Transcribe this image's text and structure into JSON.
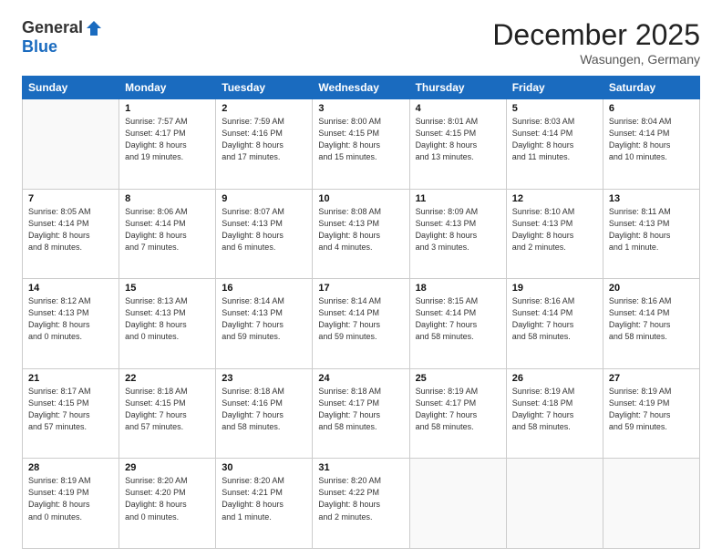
{
  "logo": {
    "general": "General",
    "blue": "Blue"
  },
  "title": {
    "month": "December 2025",
    "location": "Wasungen, Germany"
  },
  "days_of_week": [
    "Sunday",
    "Monday",
    "Tuesday",
    "Wednesday",
    "Thursday",
    "Friday",
    "Saturday"
  ],
  "weeks": [
    [
      {
        "day": "",
        "info": ""
      },
      {
        "day": "1",
        "info": "Sunrise: 7:57 AM\nSunset: 4:17 PM\nDaylight: 8 hours\nand 19 minutes."
      },
      {
        "day": "2",
        "info": "Sunrise: 7:59 AM\nSunset: 4:16 PM\nDaylight: 8 hours\nand 17 minutes."
      },
      {
        "day": "3",
        "info": "Sunrise: 8:00 AM\nSunset: 4:15 PM\nDaylight: 8 hours\nand 15 minutes."
      },
      {
        "day": "4",
        "info": "Sunrise: 8:01 AM\nSunset: 4:15 PM\nDaylight: 8 hours\nand 13 minutes."
      },
      {
        "day": "5",
        "info": "Sunrise: 8:03 AM\nSunset: 4:14 PM\nDaylight: 8 hours\nand 11 minutes."
      },
      {
        "day": "6",
        "info": "Sunrise: 8:04 AM\nSunset: 4:14 PM\nDaylight: 8 hours\nand 10 minutes."
      }
    ],
    [
      {
        "day": "7",
        "info": "Sunrise: 8:05 AM\nSunset: 4:14 PM\nDaylight: 8 hours\nand 8 minutes."
      },
      {
        "day": "8",
        "info": "Sunrise: 8:06 AM\nSunset: 4:14 PM\nDaylight: 8 hours\nand 7 minutes."
      },
      {
        "day": "9",
        "info": "Sunrise: 8:07 AM\nSunset: 4:13 PM\nDaylight: 8 hours\nand 6 minutes."
      },
      {
        "day": "10",
        "info": "Sunrise: 8:08 AM\nSunset: 4:13 PM\nDaylight: 8 hours\nand 4 minutes."
      },
      {
        "day": "11",
        "info": "Sunrise: 8:09 AM\nSunset: 4:13 PM\nDaylight: 8 hours\nand 3 minutes."
      },
      {
        "day": "12",
        "info": "Sunrise: 8:10 AM\nSunset: 4:13 PM\nDaylight: 8 hours\nand 2 minutes."
      },
      {
        "day": "13",
        "info": "Sunrise: 8:11 AM\nSunset: 4:13 PM\nDaylight: 8 hours\nand 1 minute."
      }
    ],
    [
      {
        "day": "14",
        "info": "Sunrise: 8:12 AM\nSunset: 4:13 PM\nDaylight: 8 hours\nand 0 minutes."
      },
      {
        "day": "15",
        "info": "Sunrise: 8:13 AM\nSunset: 4:13 PM\nDaylight: 8 hours\nand 0 minutes."
      },
      {
        "day": "16",
        "info": "Sunrise: 8:14 AM\nSunset: 4:13 PM\nDaylight: 7 hours\nand 59 minutes."
      },
      {
        "day": "17",
        "info": "Sunrise: 8:14 AM\nSunset: 4:14 PM\nDaylight: 7 hours\nand 59 minutes."
      },
      {
        "day": "18",
        "info": "Sunrise: 8:15 AM\nSunset: 4:14 PM\nDaylight: 7 hours\nand 58 minutes."
      },
      {
        "day": "19",
        "info": "Sunrise: 8:16 AM\nSunset: 4:14 PM\nDaylight: 7 hours\nand 58 minutes."
      },
      {
        "day": "20",
        "info": "Sunrise: 8:16 AM\nSunset: 4:14 PM\nDaylight: 7 hours\nand 58 minutes."
      }
    ],
    [
      {
        "day": "21",
        "info": "Sunrise: 8:17 AM\nSunset: 4:15 PM\nDaylight: 7 hours\nand 57 minutes."
      },
      {
        "day": "22",
        "info": "Sunrise: 8:18 AM\nSunset: 4:15 PM\nDaylight: 7 hours\nand 57 minutes."
      },
      {
        "day": "23",
        "info": "Sunrise: 8:18 AM\nSunset: 4:16 PM\nDaylight: 7 hours\nand 58 minutes."
      },
      {
        "day": "24",
        "info": "Sunrise: 8:18 AM\nSunset: 4:17 PM\nDaylight: 7 hours\nand 58 minutes."
      },
      {
        "day": "25",
        "info": "Sunrise: 8:19 AM\nSunset: 4:17 PM\nDaylight: 7 hours\nand 58 minutes."
      },
      {
        "day": "26",
        "info": "Sunrise: 8:19 AM\nSunset: 4:18 PM\nDaylight: 7 hours\nand 58 minutes."
      },
      {
        "day": "27",
        "info": "Sunrise: 8:19 AM\nSunset: 4:19 PM\nDaylight: 7 hours\nand 59 minutes."
      }
    ],
    [
      {
        "day": "28",
        "info": "Sunrise: 8:19 AM\nSunset: 4:19 PM\nDaylight: 8 hours\nand 0 minutes."
      },
      {
        "day": "29",
        "info": "Sunrise: 8:20 AM\nSunset: 4:20 PM\nDaylight: 8 hours\nand 0 minutes."
      },
      {
        "day": "30",
        "info": "Sunrise: 8:20 AM\nSunset: 4:21 PM\nDaylight: 8 hours\nand 1 minute."
      },
      {
        "day": "31",
        "info": "Sunrise: 8:20 AM\nSunset: 4:22 PM\nDaylight: 8 hours\nand 2 minutes."
      },
      {
        "day": "",
        "info": ""
      },
      {
        "day": "",
        "info": ""
      },
      {
        "day": "",
        "info": ""
      }
    ]
  ]
}
